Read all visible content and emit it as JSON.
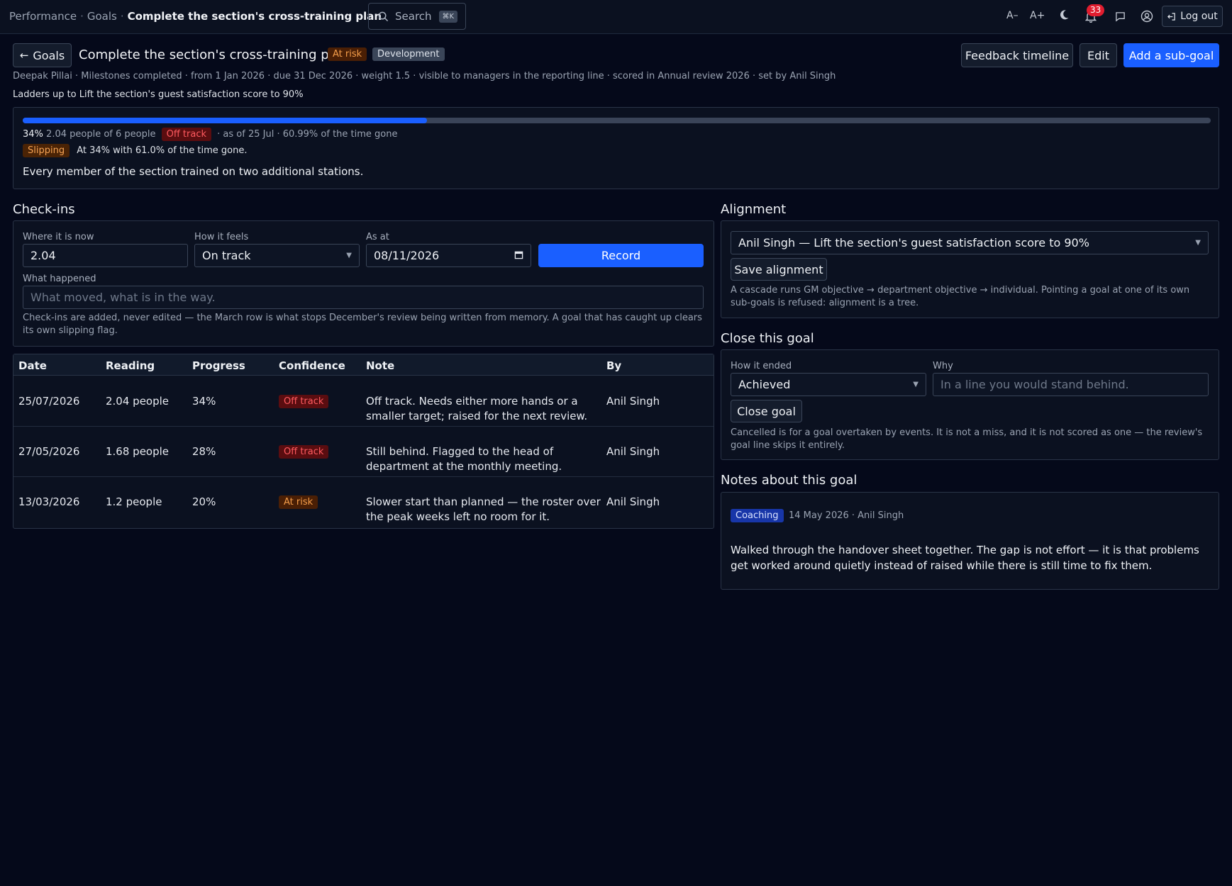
{
  "breadcrumb": {
    "root": "Performance",
    "goals": "Goals",
    "current": "Complete the section's cross-training plan"
  },
  "search": {
    "label": "Search",
    "shortcut": "⌘K"
  },
  "topbar": {
    "font_smaller": "A–",
    "font_larger": "A+",
    "notifications_count": "33",
    "logout_label": "Log out"
  },
  "header": {
    "back_label": "Goals",
    "title": "Complete the section's cross-training plan",
    "status_badge": "At risk",
    "category_badge": "Development",
    "feedback_label": "Feedback timeline",
    "edit_label": "Edit",
    "add_subgoal_label": "Add a sub-goal",
    "meta": "Deepak Pillai · Milestones completed · from 1 Jan 2026 · due 31 Dec 2026 · weight 1.5 · visible to managers in the reporting line · scored in Annual review 2026 · set by Anil Singh",
    "ladder": "Ladders up to Lift the section's guest satisfaction score to 90%"
  },
  "progress": {
    "percent_value": 34,
    "percent_label": "34%",
    "reading": "2.04 people of 6 people",
    "status": "Off track",
    "as_of": "· as of 25 Jul · 60.99% of the time gone",
    "slip_badge": "Slipping",
    "slip_text": "At 34% with 61.0% of the time gone.",
    "description": "Every member of the section trained on two additional stations."
  },
  "checkins": {
    "heading": "Check-ins",
    "where_label": "Where it is now",
    "where_value": "2.04",
    "feels_label": "How it feels",
    "feels_value": "On track",
    "asat_label": "As at",
    "asat_value": "08/11/2026",
    "record_label": "Record",
    "happened_label": "What happened",
    "happened_placeholder": "What moved, what is in the way.",
    "helper": "Check-ins are added, never edited — the March row is what stops December's review being written from memory. A goal that has caught up clears its own slipping flag."
  },
  "table": {
    "columns": [
      "Date",
      "Reading",
      "Progress",
      "Confidence",
      "Note",
      "By"
    ],
    "rows": [
      {
        "date": "25/07/2026",
        "reading": "2.04 people",
        "progress": "34%",
        "confidence": "Off track",
        "note": "Off track. Needs either more hands or a smaller target; raised for the next review.",
        "by": "Anil Singh"
      },
      {
        "date": "27/05/2026",
        "reading": "1.68 people",
        "progress": "28%",
        "confidence": "Off track",
        "note": "Still behind. Flagged to the head of department at the monthly meeting.",
        "by": "Anil Singh"
      },
      {
        "date": "13/03/2026",
        "reading": "1.2 people",
        "progress": "20%",
        "confidence": "At risk",
        "note": "Slower start than planned — the roster over the peak weeks left no room for it.",
        "by": "Anil Singh"
      }
    ]
  },
  "alignment": {
    "heading": "Alignment",
    "selected": "Anil Singh — Lift the section's guest satisfaction score to 90%",
    "save_label": "Save alignment",
    "helper": "A cascade runs GM objective → department objective → individual. Pointing a goal at one of its own sub-goals is refused: alignment is a tree."
  },
  "close": {
    "heading": "Close this goal",
    "ended_label": "How it ended",
    "ended_value": "Achieved",
    "why_label": "Why",
    "why_placeholder": "In a line you would stand behind.",
    "close_label": "Close goal",
    "helper": "Cancelled is for a goal overtaken by events. It is not a miss, and it is not scored as one — the review's goal line skips it entirely."
  },
  "notes": {
    "heading": "Notes about this goal",
    "tag": "Coaching",
    "meta": "14 May 2026 · Anil Singh",
    "body": "Walked through the handover sheet together. The gap is not effort — it is that problems get worked around quietly instead of raised while there is still time to fix them."
  },
  "colors": {
    "accent": "#1a5fff",
    "off_track": "#ff5a5f",
    "at_risk": "#f59e4a",
    "background": "#05091a"
  }
}
